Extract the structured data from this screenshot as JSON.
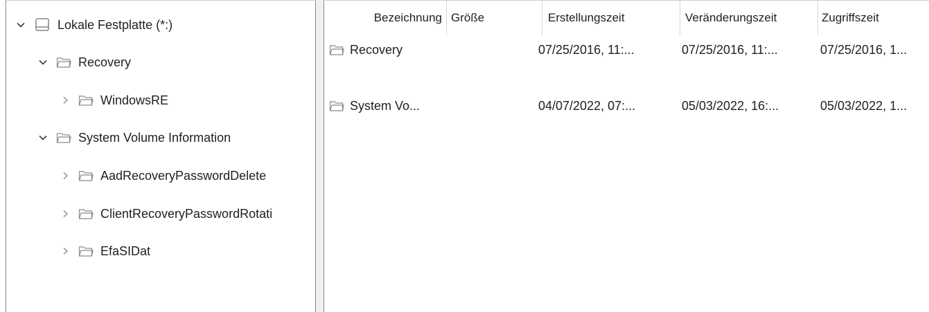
{
  "tree": {
    "items": [
      {
        "label": "Lokale Festplatte (*:)",
        "expanded": true,
        "icon": "drive-icon"
      },
      {
        "label": "Recovery",
        "expanded": true,
        "icon": "folder-icon"
      },
      {
        "label": "WindowsRE",
        "expanded": false,
        "icon": "folder-icon"
      },
      {
        "label": "System Volume Information",
        "expanded": true,
        "icon": "folder-icon"
      },
      {
        "label": "AadRecoveryPasswordDelete",
        "expanded": false,
        "icon": "folder-icon"
      },
      {
        "label": "ClientRecoveryPasswordRotati",
        "expanded": false,
        "icon": "folder-icon"
      },
      {
        "label": "EfaSIDat",
        "expanded": false,
        "icon": "folder-icon"
      }
    ]
  },
  "list": {
    "columns": [
      "Bezeichnung",
      "Größe",
      "Erstellungszeit",
      "Veränderungszeit",
      "Zugriffszeit"
    ],
    "rows": [
      {
        "name": "Recovery",
        "size": "",
        "created": "07/25/2016, 11:...",
        "modified": "07/25/2016, 11:...",
        "accessed": "07/25/2016, 1..."
      },
      {
        "name": "System Vo...",
        "size": "",
        "created": "04/07/2022, 07:...",
        "modified": "05/03/2022, 16:...",
        "accessed": "05/03/2022, 1..."
      }
    ]
  }
}
